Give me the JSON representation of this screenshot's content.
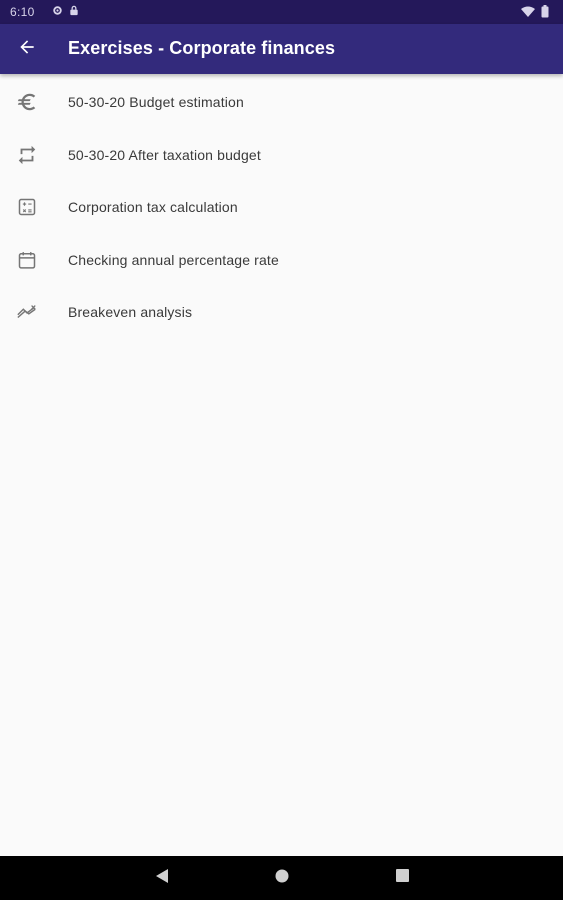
{
  "status_bar": {
    "time": "6:10",
    "icons": [
      "gear-icon",
      "lock-icon",
      "wifi-icon",
      "battery-icon"
    ]
  },
  "app_bar": {
    "title": "Exercises - Corporate finances",
    "back_icon": "arrow-back-icon",
    "background": "#332a7c"
  },
  "exercises": [
    {
      "label": "50-30-20 Budget estimation",
      "icon": "euro-icon"
    },
    {
      "label": "50-30-20 After taxation budget",
      "icon": "repeat-icon"
    },
    {
      "label": "Corporation tax calculation",
      "icon": "calculator-icon"
    },
    {
      "label": "Checking annual percentage rate",
      "icon": "calendar-icon"
    },
    {
      "label": "Breakeven analysis",
      "icon": "breakeven-chart-icon"
    }
  ],
  "nav_bar": {
    "buttons": [
      "back-triangle-icon",
      "home-circle-icon",
      "recents-square-icon"
    ]
  }
}
